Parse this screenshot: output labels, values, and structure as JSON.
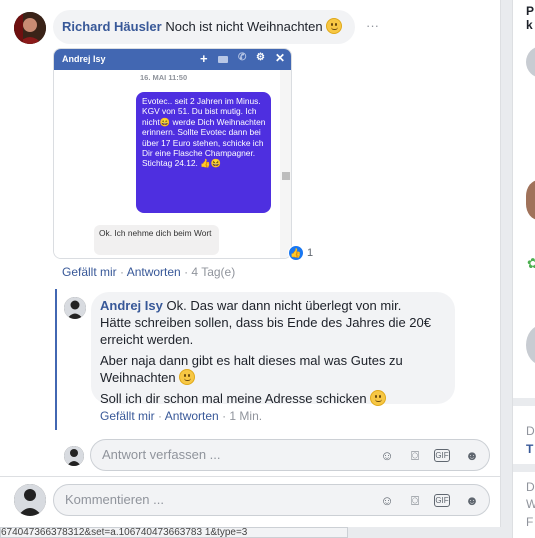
{
  "comment": {
    "author": "Richard Häusler",
    "text": "Noch ist nicht Weihnachten",
    "options": "···",
    "actions": {
      "like": "Gefällt mir",
      "sep": "·",
      "reply": "Antworten",
      "time": "4 Tag(e)"
    },
    "reactions_count": "1",
    "screenshot": {
      "title": "Andrej Isy",
      "date": "16. MAI 11:50",
      "sent_message": "Evotec.. seit 2 Jahren im Minus. KGV von 51. Du bist mutig. Ich nicht😄 werde Dich Weihnachten erinnern. Sollte Evotec dann bei über 17 Euro stehen, schicke ich Dir eine Flasche Champagner. Stichtag 24.12. 👍😆",
      "received_message": "Ok. Ich nehme dich beim Wort",
      "header_icons": [
        "plus-icon",
        "video-icon",
        "phone-icon",
        "gear-icon",
        "close-icon"
      ]
    }
  },
  "reply": {
    "author": "Andrej Isy",
    "line1": "Ok. Das war dann nicht überlegt von mir.",
    "line2": "Hätte schreiben sollen, dass bis Ende des Jahres die 20€",
    "line3": "erreicht werden.",
    "line4": "Aber naja dann gibt es halt dieses mal was Gutes zu",
    "line5": "Weihnachten",
    "line6": "Soll ich dir schon mal meine Adresse schicken",
    "actions": {
      "like": "Gefällt mir",
      "sep": "·",
      "reply": "Antworten",
      "time": "1 Min."
    }
  },
  "reply_input": {
    "placeholder": "Antwort verfassen ..."
  },
  "comment_input": {
    "placeholder": "Kommentieren ..."
  },
  "input_tools": [
    "emoji-icon",
    "camera-icon",
    "gif-icon",
    "sticker-icon"
  ],
  "right_rail": {
    "t1": "P",
    "t2": "k",
    "t3": "D",
    "t4": "T",
    "t5": "D",
    "t6": "W",
    "t7": "F"
  },
  "status_bar": "674047366378312&set=a.106740473663783 1&type=3"
}
